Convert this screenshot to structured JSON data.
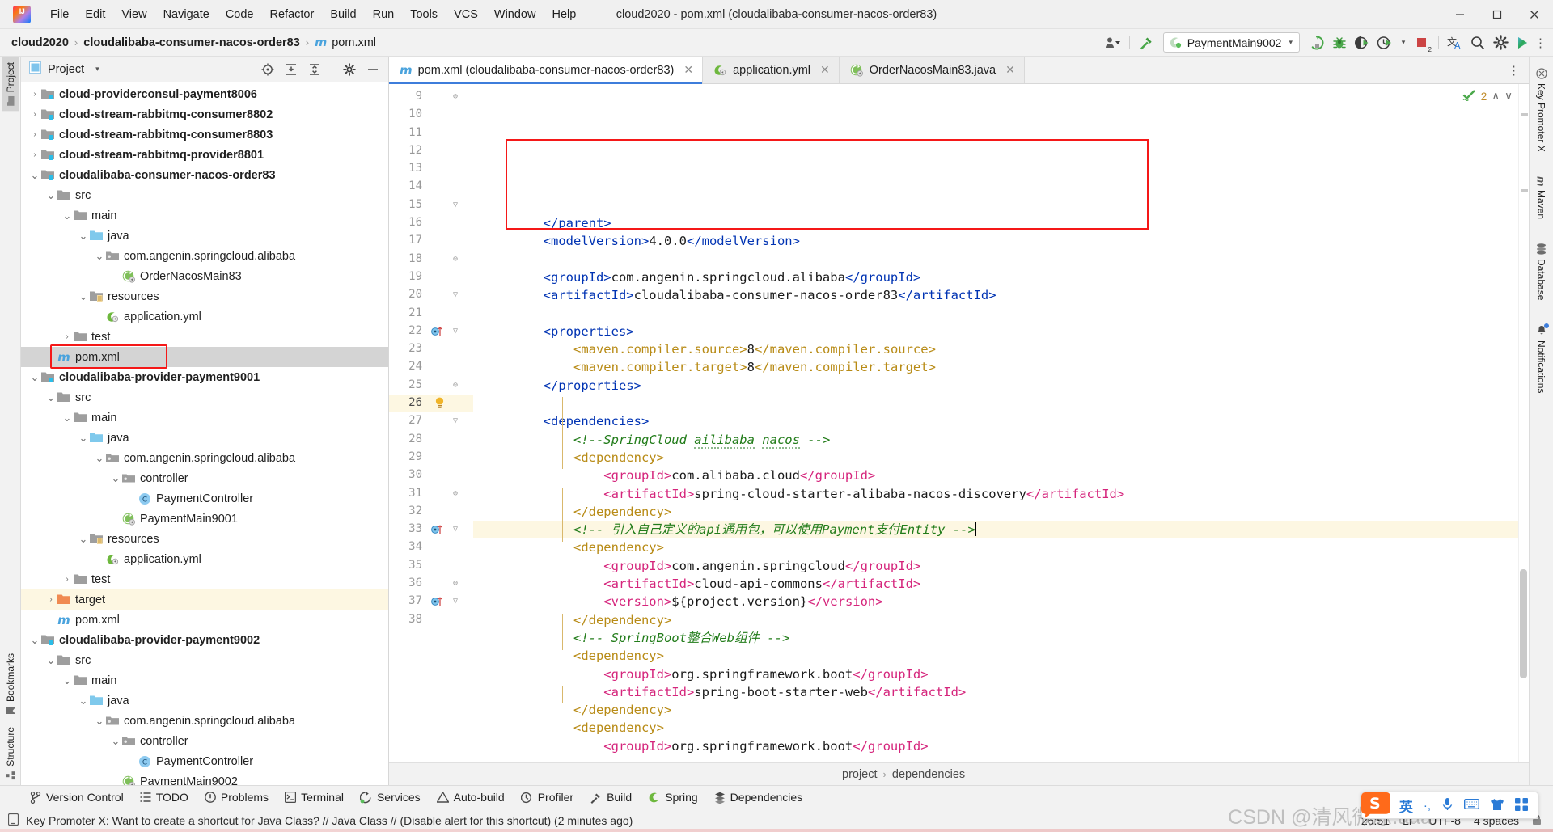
{
  "window": {
    "title": "cloud2020 - pom.xml (cloudalibaba-consumer-nacos-order83)",
    "minimize": "—",
    "maximize": "▢",
    "close": "✕"
  },
  "menubar": [
    {
      "label": "File"
    },
    {
      "label": "Edit"
    },
    {
      "label": "View"
    },
    {
      "label": "Navigate"
    },
    {
      "label": "Code"
    },
    {
      "label": "Refactor"
    },
    {
      "label": "Build"
    },
    {
      "label": "Run"
    },
    {
      "label": "Tools"
    },
    {
      "label": "VCS"
    },
    {
      "label": "Window"
    },
    {
      "label": "Help"
    }
  ],
  "breadcrumb": {
    "items": [
      "cloud2020",
      "cloudalibaba-consumer-nacos-order83",
      "pom.xml"
    ],
    "separator": "›"
  },
  "navbar_right": {
    "account_icon": "user-dropdown-icon",
    "build_icon": "hammer-icon",
    "run_config": "PaymentMain9002",
    "run_icon": "run-icon",
    "debug_icon": "debug-icon",
    "coverage_icon": "run-with-coverage-icon",
    "profiler_icon": "profiler-icon",
    "stop_icon": "stop-icon",
    "stop_count": "2",
    "translate_icon": "translate-icon",
    "search_icon": "search-icon",
    "settings_icon": "gear-icon",
    "ide_icon": "ide-features-trainer-icon"
  },
  "left_rail": {
    "top": [
      {
        "label": "Project",
        "icon": "project-icon",
        "active": true
      }
    ],
    "bottom": [
      {
        "label": "Bookmarks",
        "icon": "bookmark-icon"
      },
      {
        "label": "Structure",
        "icon": "structure-icon"
      }
    ]
  },
  "right_rail": [
    {
      "label": "Key Promoter X",
      "icon": "key-promoter-icon"
    },
    {
      "label": "Maven",
      "icon": "maven-icon"
    },
    {
      "label": "Database",
      "icon": "database-icon"
    },
    {
      "label": "Notifications",
      "icon": "notifications-icon"
    }
  ],
  "project_panel": {
    "title": "Project",
    "caret": "▾",
    "tools": [
      "locate-icon",
      "expand-all-icon",
      "collapse-all-icon",
      "gear-icon",
      "hide-icon"
    ],
    "tree": [
      {
        "label": "cloud-providerconsul-payment8006",
        "depth": 1,
        "arrow": "›",
        "icon": "module-folder",
        "bold": true
      },
      {
        "label": "cloud-stream-rabbitmq-consumer8802",
        "depth": 1,
        "arrow": "›",
        "icon": "module-folder",
        "bold": true
      },
      {
        "label": "cloud-stream-rabbitmq-consumer8803",
        "depth": 1,
        "arrow": "›",
        "icon": "module-folder",
        "bold": true
      },
      {
        "label": "cloud-stream-rabbitmq-provider8801",
        "depth": 1,
        "arrow": "›",
        "icon": "module-folder",
        "bold": true
      },
      {
        "label": "cloudalibaba-consumer-nacos-order83",
        "depth": 1,
        "arrow": "⌄",
        "icon": "module-folder",
        "bold": true
      },
      {
        "label": "src",
        "depth": 2,
        "arrow": "⌄",
        "icon": "folder"
      },
      {
        "label": "main",
        "depth": 3,
        "arrow": "⌄",
        "icon": "folder"
      },
      {
        "label": "java",
        "depth": 4,
        "arrow": "⌄",
        "icon": "source-folder"
      },
      {
        "label": "com.angenin.springcloud.alibaba",
        "depth": 5,
        "arrow": "⌄",
        "icon": "package"
      },
      {
        "label": "OrderNacosMain83",
        "depth": 6,
        "arrow": "",
        "icon": "spring-class"
      },
      {
        "label": "resources",
        "depth": 4,
        "arrow": "⌄",
        "icon": "resources-folder"
      },
      {
        "label": "application.yml",
        "depth": 5,
        "arrow": "",
        "icon": "spring-yaml"
      },
      {
        "label": "test",
        "depth": 3,
        "arrow": "›",
        "icon": "folder"
      },
      {
        "label": "pom.xml",
        "depth": 2,
        "arrow": "",
        "icon": "maven-file",
        "selected": true,
        "highlighted": true
      },
      {
        "label": "cloudalibaba-provider-payment9001",
        "depth": 1,
        "arrow": "⌄",
        "icon": "module-folder",
        "bold": true
      },
      {
        "label": "src",
        "depth": 2,
        "arrow": "⌄",
        "icon": "folder"
      },
      {
        "label": "main",
        "depth": 3,
        "arrow": "⌄",
        "icon": "folder"
      },
      {
        "label": "java",
        "depth": 4,
        "arrow": "⌄",
        "icon": "source-folder"
      },
      {
        "label": "com.angenin.springcloud.alibaba",
        "depth": 5,
        "arrow": "⌄",
        "icon": "package"
      },
      {
        "label": "controller",
        "depth": 6,
        "arrow": "⌄",
        "icon": "package"
      },
      {
        "label": "PaymentController",
        "depth": 7,
        "arrow": "",
        "icon": "java-class"
      },
      {
        "label": "PaymentMain9001",
        "depth": 6,
        "arrow": "",
        "icon": "spring-class"
      },
      {
        "label": "resources",
        "depth": 4,
        "arrow": "⌄",
        "icon": "resources-folder"
      },
      {
        "label": "application.yml",
        "depth": 5,
        "arrow": "",
        "icon": "spring-yaml"
      },
      {
        "label": "test",
        "depth": 3,
        "arrow": "›",
        "icon": "folder"
      },
      {
        "label": "target",
        "depth": 2,
        "arrow": "›",
        "icon": "target-folder",
        "rowYellow": true
      },
      {
        "label": "pom.xml",
        "depth": 2,
        "arrow": "",
        "icon": "maven-file"
      },
      {
        "label": "cloudalibaba-provider-payment9002",
        "depth": 1,
        "arrow": "⌄",
        "icon": "module-folder",
        "bold": true
      },
      {
        "label": "src",
        "depth": 2,
        "arrow": "⌄",
        "icon": "folder"
      },
      {
        "label": "main",
        "depth": 3,
        "arrow": "⌄",
        "icon": "folder"
      },
      {
        "label": "java",
        "depth": 4,
        "arrow": "⌄",
        "icon": "source-folder"
      },
      {
        "label": "com.angenin.springcloud.alibaba",
        "depth": 5,
        "arrow": "⌄",
        "icon": "package"
      },
      {
        "label": "controller",
        "depth": 6,
        "arrow": "⌄",
        "icon": "package"
      },
      {
        "label": "PaymentController",
        "depth": 7,
        "arrow": "",
        "icon": "java-class"
      },
      {
        "label": "PaymentMain9002",
        "depth": 6,
        "arrow": "",
        "icon": "spring-class"
      }
    ]
  },
  "editor": {
    "tabs": [
      {
        "label": "pom.xml (cloudalibaba-consumer-nacos-order83)",
        "icon": "maven-file",
        "active": true,
        "close": "✕"
      },
      {
        "label": "application.yml",
        "icon": "spring-yaml",
        "active": false,
        "close": "✕"
      },
      {
        "label": "OrderNacosMain83.java",
        "icon": "spring-class",
        "active": false,
        "close": "✕"
      }
    ],
    "inspection": {
      "count": "2",
      "icon": "inspections-ok-icon",
      "up": "∧",
      "down": "∨"
    },
    "first_line": 9,
    "current_line": 26,
    "bottom_breadcrumb": [
      "project",
      "dependencies"
    ],
    "lines": [
      {
        "n": 9,
        "fold": "⊖",
        "segs": [
          {
            "t": "tag",
            "v": "        </parent>"
          }
        ]
      },
      {
        "n": 10,
        "segs": [
          {
            "t": "tag",
            "v": "        <modelVersion>"
          },
          {
            "t": "txt",
            "v": "4.0.0"
          },
          {
            "t": "tag",
            "v": "</modelVersion>"
          }
        ]
      },
      {
        "n": 11,
        "segs": []
      },
      {
        "n": 12,
        "segs": [
          {
            "t": "tag",
            "v": "        <groupId>"
          },
          {
            "t": "txt",
            "v": "com.angenin.springcloud.alibaba"
          },
          {
            "t": "tag",
            "v": "</groupId>"
          }
        ]
      },
      {
        "n": 13,
        "segs": [
          {
            "t": "tag",
            "v": "        <artifactId>"
          },
          {
            "t": "txt",
            "v": "cloudalibaba-consumer-nacos-order83"
          },
          {
            "t": "tag",
            "v": "</artifactId>"
          }
        ]
      },
      {
        "n": 14,
        "segs": []
      },
      {
        "n": 15,
        "fold": "▽",
        "segs": [
          {
            "t": "tag",
            "v": "        <properties>"
          }
        ]
      },
      {
        "n": 16,
        "segs": [
          {
            "t": "tagy",
            "v": "            <maven.compiler.source>"
          },
          {
            "t": "txt",
            "v": "8"
          },
          {
            "t": "tagy",
            "v": "</maven.compiler.source>"
          }
        ]
      },
      {
        "n": 17,
        "segs": [
          {
            "t": "tagy",
            "v": "            <maven.compiler.target>"
          },
          {
            "t": "txt",
            "v": "8"
          },
          {
            "t": "tagy",
            "v": "</maven.compiler.target>"
          }
        ]
      },
      {
        "n": 18,
        "fold": "⊖",
        "segs": [
          {
            "t": "tag",
            "v": "        </properties>"
          }
        ]
      },
      {
        "n": 19,
        "segs": []
      },
      {
        "n": 20,
        "fold": "▽",
        "segs": [
          {
            "t": "tag",
            "v": "        <dependencies>"
          }
        ]
      },
      {
        "n": 21,
        "segs": [
          {
            "t": "cmt",
            "v": "            <!--SpringCloud "
          },
          {
            "t": "typo",
            "v": "ailibaba"
          },
          {
            "t": "cmt",
            "v": " "
          },
          {
            "t": "typo",
            "v": "nacos"
          },
          {
            "t": "cmt",
            "v": " -->"
          }
        ]
      },
      {
        "n": 22,
        "marker": "bean",
        "fold": "▽",
        "segs": [
          {
            "t": "tagy",
            "v": "            <dependency>"
          }
        ]
      },
      {
        "n": 23,
        "segs": [
          {
            "t": "tagp",
            "v": "                <groupId>"
          },
          {
            "t": "txt",
            "v": "com.alibaba.cloud"
          },
          {
            "t": "tagp",
            "v": "</groupId>"
          }
        ]
      },
      {
        "n": 24,
        "segs": [
          {
            "t": "tagp",
            "v": "                <artifactId>"
          },
          {
            "t": "txt",
            "v": "spring-cloud-starter-alibaba-nacos-discovery"
          },
          {
            "t": "tagp",
            "v": "</artifactId>"
          }
        ]
      },
      {
        "n": 25,
        "fold": "⊖",
        "segs": [
          {
            "t": "tagy",
            "v": "            </dependency>"
          }
        ]
      },
      {
        "n": 26,
        "marker": "bulb",
        "current": true,
        "segs": [
          {
            "t": "cmt",
            "v": "            <!-- 引入自己定义的api通用包，可以使用Payment支付Entity -->"
          },
          {
            "t": "caret",
            "v": ""
          }
        ]
      },
      {
        "n": 27,
        "fold": "▽",
        "segs": [
          {
            "t": "tagy",
            "v": "            <dependency>"
          }
        ]
      },
      {
        "n": 28,
        "segs": [
          {
            "t": "tagp",
            "v": "                <groupId>"
          },
          {
            "t": "txt",
            "v": "com.angenin.springcloud"
          },
          {
            "t": "tagp",
            "v": "</groupId>"
          }
        ]
      },
      {
        "n": 29,
        "segs": [
          {
            "t": "tagp",
            "v": "                <artifactId>"
          },
          {
            "t": "txt",
            "v": "cloud-api-commons"
          },
          {
            "t": "tagp",
            "v": "</artifactId>"
          }
        ]
      },
      {
        "n": 30,
        "segs": [
          {
            "t": "tagp",
            "v": "                <version>"
          },
          {
            "t": "txt",
            "v": "${project.version}"
          },
          {
            "t": "tagp",
            "v": "</version>"
          }
        ]
      },
      {
        "n": 31,
        "fold": "⊖",
        "segs": [
          {
            "t": "tagy",
            "v": "            </dependency>"
          }
        ]
      },
      {
        "n": 32,
        "segs": [
          {
            "t": "cmt",
            "v": "            <!-- SpringBoot整合Web组件 -->"
          }
        ]
      },
      {
        "n": 33,
        "marker": "bean",
        "fold": "▽",
        "segs": [
          {
            "t": "tagy",
            "v": "            <dependency>"
          }
        ]
      },
      {
        "n": 34,
        "segs": [
          {
            "t": "tagp",
            "v": "                <groupId>"
          },
          {
            "t": "txt",
            "v": "org.springframework.boot"
          },
          {
            "t": "tagp",
            "v": "</groupId>"
          }
        ]
      },
      {
        "n": 35,
        "segs": [
          {
            "t": "tagp",
            "v": "                <artifactId>"
          },
          {
            "t": "txt",
            "v": "spring-boot-starter-web"
          },
          {
            "t": "tagp",
            "v": "</artifactId>"
          }
        ]
      },
      {
        "n": 36,
        "fold": "⊖",
        "segs": [
          {
            "t": "tagy",
            "v": "            </dependency>"
          }
        ]
      },
      {
        "n": 37,
        "marker": "bean",
        "fold": "▽",
        "segs": [
          {
            "t": "tagy",
            "v": "            <dependency>"
          }
        ]
      },
      {
        "n": 38,
        "segs": [
          {
            "t": "tagp",
            "v": "                <groupId>"
          },
          {
            "t": "txt",
            "v": "org.springframework.boot"
          },
          {
            "t": "tagp",
            "v": "</groupId>"
          }
        ]
      }
    ]
  },
  "bottom_tools": [
    {
      "label": "Version Control",
      "icon": "branch-icon"
    },
    {
      "label": "TODO",
      "icon": "todo-icon"
    },
    {
      "label": "Problems",
      "icon": "problems-icon"
    },
    {
      "label": "Terminal",
      "icon": "terminal-icon"
    },
    {
      "label": "Services",
      "icon": "services-icon"
    },
    {
      "label": "Auto-build",
      "icon": "auto-build-icon"
    },
    {
      "label": "Profiler",
      "icon": "profiler-icon"
    },
    {
      "label": "Build",
      "icon": "hammer-icon"
    },
    {
      "label": "Spring",
      "icon": "spring-icon"
    },
    {
      "label": "Dependencies",
      "icon": "dependencies-icon"
    }
  ],
  "statusbar": {
    "message": "Key Promoter X: Want to create a shortcut for Java Class? // Java Class // (Disable alert for this shortcut) (2 minutes ago)",
    "message_icon": "notification-icon",
    "caret_position": "26:51",
    "line_separator": "LF",
    "encoding": "UTF-8",
    "indent": "4 spaces",
    "lock_icon": "lock-icon"
  },
  "ime_bar": {
    "logo": "sogou-logo",
    "mode": "英",
    "punct": "·,",
    "voice_icon": "microphone-icon",
    "keyboard_icon": "keyboard-icon",
    "skin_icon": "tshirt-icon",
    "apps_icon": "apps-icon"
  },
  "watermark": "CSDN @清风微凉.aaa",
  "colors": {
    "accent": "#3d7ddb",
    "red_box": "#f51818",
    "tag_blue": "#0033b3",
    "tag_yellow": "#b88b16",
    "tag_pink": "#d5257c",
    "comment_green": "#227c1a",
    "selected_row": "#d4d4d4",
    "current_line": "#fdf7e2"
  }
}
